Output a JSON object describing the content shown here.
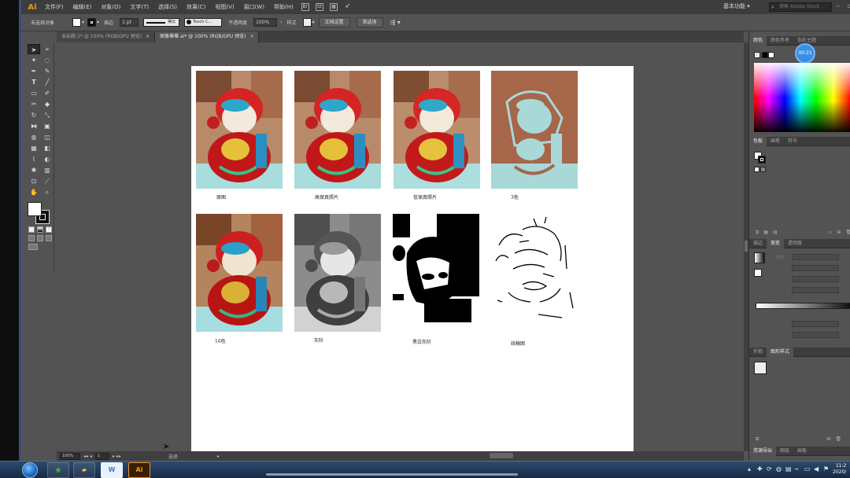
{
  "app": {
    "logo": "Ai"
  },
  "menu": {
    "items": [
      "文件(F)",
      "编辑(E)",
      "对象(O)",
      "文字(T)",
      "选择(S)",
      "效果(C)",
      "视图(V)",
      "窗口(W)",
      "帮助(H)"
    ],
    "bridge_icon": "Br",
    "stock_icon": "St",
    "workspace": "基本功能",
    "search_placeholder": "搜索 Adobe Stock"
  },
  "control": {
    "selection_label": "未选择对象",
    "stroke_label": "描边",
    "stroke_weight": "1 pt",
    "stroke_style": "等比",
    "brush": "Touch C...",
    "opacity_label": "不透明度",
    "opacity_value": "100%",
    "style_label": "样式",
    "doc_setup_button": "文档设置",
    "preferences_button": "首选项"
  },
  "tabs": [
    {
      "label": "未标题-1* @ 100% (RGB/GPU 预览)",
      "close": "×",
      "active": false
    },
    {
      "label": "图像摹摹.ai* @ 100% (RGB/GPU 预览)",
      "close": "×",
      "active": true
    }
  ],
  "artboard": {
    "captions": [
      "原图",
      "高保真照片",
      "低保真照片",
      "3色",
      "16色",
      "灰阶",
      "黑白灰阶",
      "线稿图"
    ]
  },
  "status": {
    "zoom": "100%",
    "page": "1",
    "mode": "选择"
  },
  "right_panel": {
    "color_tabs": [
      "颜色",
      "颜色参考",
      "色彩主题"
    ],
    "timer": "00:21",
    "swatch_tabs": [
      "色板",
      "画笔",
      "符号"
    ],
    "gradient_tabs": [
      "描边",
      "渐变",
      "透明度"
    ],
    "gradient_type_label": "类型",
    "style_tabs": [
      "外观",
      "图形样式"
    ],
    "bottom_tabs": [
      "资源导出",
      "图层",
      "画板"
    ]
  },
  "taskbar": {
    "clock_time": "11:2",
    "clock_date": "2020/"
  },
  "colors": {
    "accent_orange": "#f7931e",
    "timer_blue": "#3b8fe0"
  }
}
